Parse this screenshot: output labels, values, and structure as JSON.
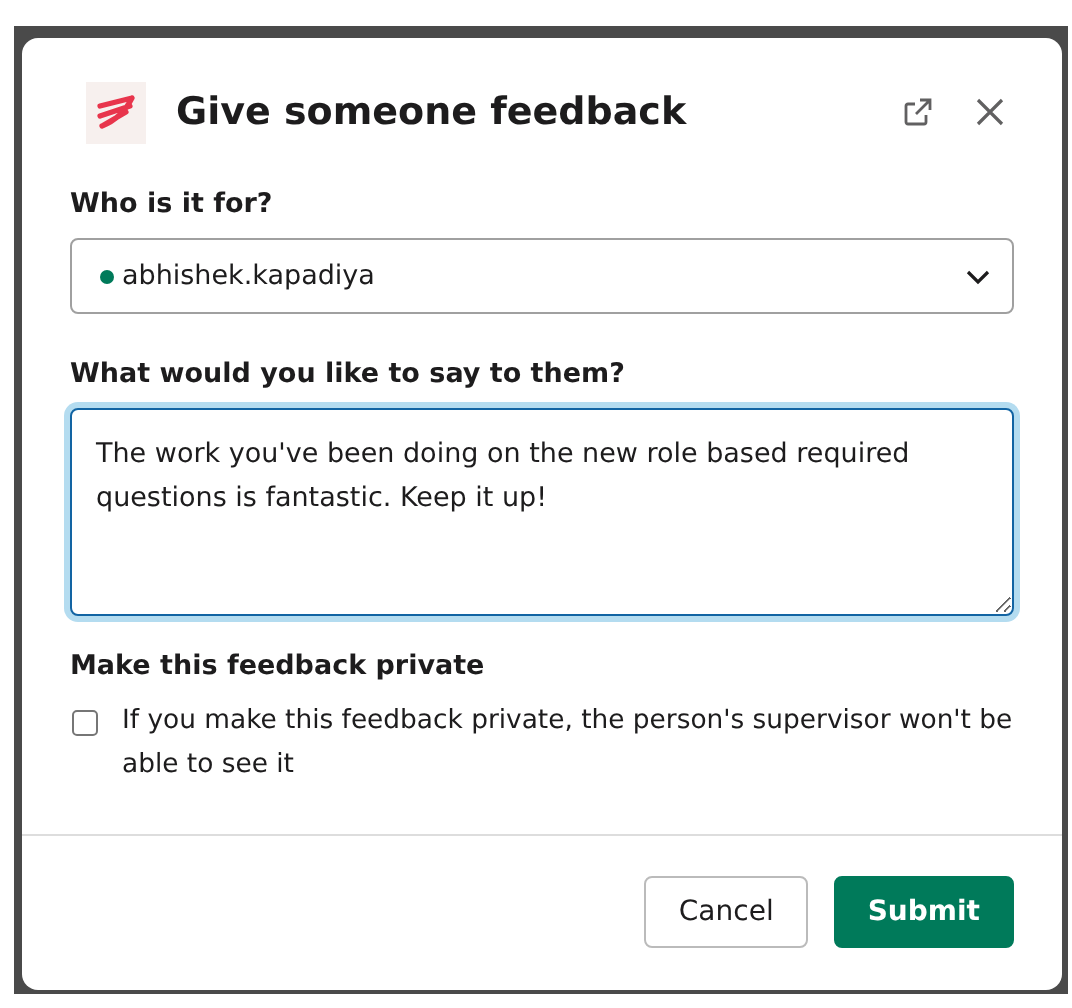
{
  "dialog": {
    "title": "Give someone feedback"
  },
  "recipient": {
    "label": "Who is it for?",
    "value": "abhishek.kapadiya",
    "online": true
  },
  "message": {
    "label": "What would you like to say to them?",
    "value": "The work you've been doing on the new role based required questions is fantastic. Keep it up!",
    "focused": true
  },
  "privacy": {
    "label": "Make this feedback private",
    "checkbox_text": "If you make this feedback private, the person's supervisor won't be able to see it",
    "checked": false
  },
  "buttons": [
    {
      "label": "Cancel",
      "kind": "secondary"
    },
    {
      "label": "Submit",
      "kind": "primary"
    }
  ]
}
